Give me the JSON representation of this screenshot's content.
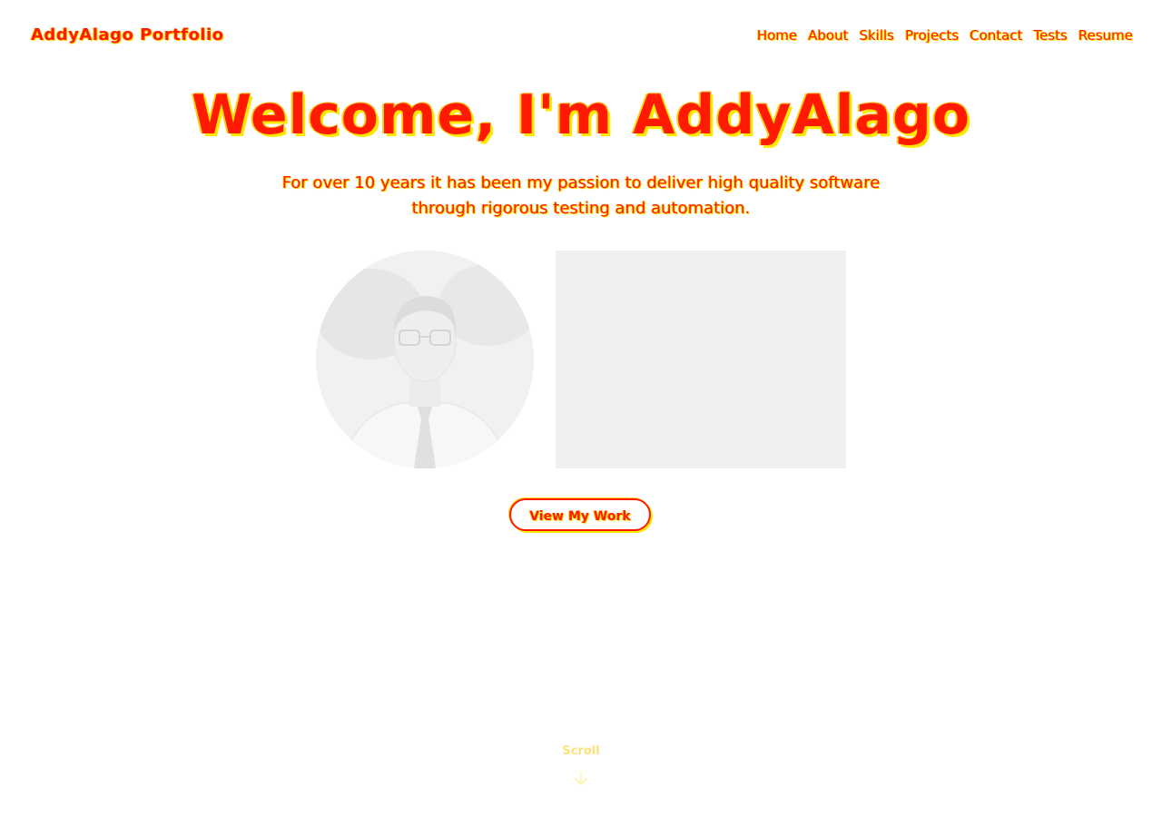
{
  "header": {
    "brand": "AddyAlago Portfolio",
    "nav": [
      "Home",
      "About",
      "Skills",
      "Projects",
      "Contact",
      "Tests",
      "Resume"
    ]
  },
  "hero": {
    "title": "Welcome, I'm AddyAlago",
    "subtitle": "For over 10 years it has been my passion to deliver high quality software through rigorous testing and automation.",
    "cta_label": "View My Work"
  },
  "scroll": {
    "label": "Scroll"
  },
  "icons": {
    "scroll": "arrow-down-icon"
  },
  "colors": {
    "accent": "#ff1a00",
    "highlight": "#ffe800",
    "placeholder": "#efefef"
  }
}
